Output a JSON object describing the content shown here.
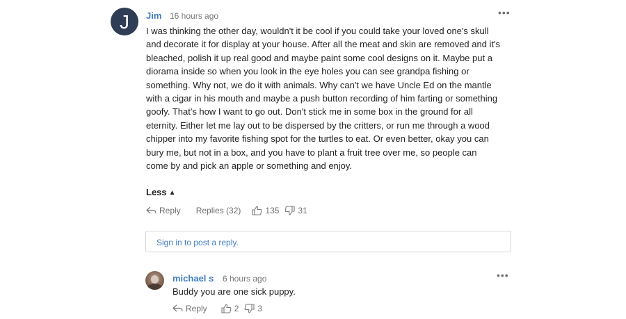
{
  "comment": {
    "author": "Jim",
    "time": "16 hours ago",
    "more_label": "•••",
    "body": "I was thinking the other day, wouldn't it be cool if you could take your loved one's skull and decorate it for display at your house. After all the meat and skin are removed and it's bleached, polish it up real good and maybe paint some cool designs on it. Maybe put a diorama inside so when you look in the eye holes you can see grandpa fishing or something. Why not, we do it with animals. Why can't we have Uncle Ed on the mantle with a cigar in his mouth and maybe a push button recording of him farting or something goofy. That's how I want to go out. Don't stick me in some box in the ground for all eternity. Either let me lay out to be dispersed by the critters, or run me through a wood chipper into my favorite fishing spot for the turtles to eat. Or even better, okay you can bury me, but not in a box, and you have to plant a fruit tree over me, so people can come by and pick an apple or something and enjoy.",
    "less_label": "Less",
    "reply_label": "Reply",
    "replies_label": "Replies (32)",
    "likes": "135",
    "dislikes": "31",
    "avatar_letter": "J"
  },
  "reply_box": {
    "prompt": "Sign in to post a reply."
  },
  "reply": {
    "author": "michael s",
    "time": "6 hours ago",
    "more_label": "•••",
    "body": "Buddy you are one sick puppy.",
    "reply_label": "Reply",
    "likes": "2",
    "dislikes": "3"
  },
  "icons": {
    "reply": "reply-arrow-icon",
    "like": "thumbs-up-icon",
    "dislike": "thumbs-down-icon",
    "more": "more-dots-icon",
    "chevron": "chevron-up-icon"
  },
  "colors": {
    "link": "#3f7dc4",
    "muted": "#777777",
    "avatar_bg": "#2f3d55"
  }
}
